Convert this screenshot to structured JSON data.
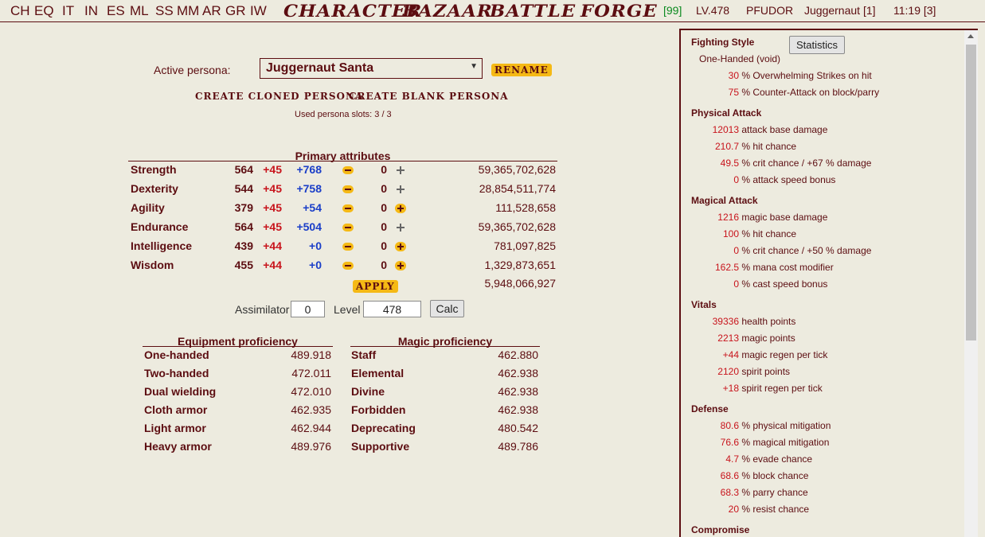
{
  "nav": {
    "shortcuts": [
      "CH",
      "EQ",
      "IT",
      "IN",
      "ES",
      "ML",
      "SS",
      "MM",
      "AR",
      "GR",
      "IW"
    ],
    "menus": [
      "CHARACTER",
      "BAZAAR",
      "BATTLE",
      "FORGE"
    ],
    "notice": "[99]",
    "level": "LV.478",
    "difficulty": "PFUDOR",
    "persona": "Juggernaut [1]",
    "time": "11:19 [3]"
  },
  "persona": {
    "label": "Active persona:",
    "selected": "Juggernaut Santa",
    "rename": "RENAME",
    "create_cloned": "CREATE CLONED PERSONA",
    "create_blank": "CREATE BLANK PERSONA",
    "slots": "Used persona slots: 3 / 3"
  },
  "primary": {
    "heading": "Primary attributes",
    "rows": [
      {
        "name": "Strength",
        "base": "564",
        "plus": "+45",
        "bonus": "+768",
        "value": "0",
        "inc_enabled": false,
        "exp": "59,365,702,628"
      },
      {
        "name": "Dexterity",
        "base": "544",
        "plus": "+45",
        "bonus": "+758",
        "value": "0",
        "inc_enabled": false,
        "exp": "28,854,511,774"
      },
      {
        "name": "Agility",
        "base": "379",
        "plus": "+45",
        "bonus": "+54",
        "value": "0",
        "inc_enabled": true,
        "exp": "111,528,658"
      },
      {
        "name": "Endurance",
        "base": "564",
        "plus": "+45",
        "bonus": "+504",
        "value": "0",
        "inc_enabled": false,
        "exp": "59,365,702,628"
      },
      {
        "name": "Intelligence",
        "base": "439",
        "plus": "+44",
        "bonus": "+0",
        "value": "0",
        "inc_enabled": true,
        "exp": "781,097,825"
      },
      {
        "name": "Wisdom",
        "base": "455",
        "plus": "+44",
        "bonus": "+0",
        "value": "0",
        "inc_enabled": true,
        "exp": "1,329,873,651"
      }
    ],
    "apply": "APPLY",
    "total_exp": "5,948,066,927"
  },
  "calc": {
    "assimilator_label": "Assimilator",
    "assimilator_value": "0",
    "level_label": "Level",
    "level_value": "478",
    "button": "Calc"
  },
  "equipment": {
    "heading": "Equipment proficiency",
    "rows": [
      {
        "name": "One-handed",
        "value": "489.918"
      },
      {
        "name": "Two-handed",
        "value": "472.011"
      },
      {
        "name": "Dual wielding",
        "value": "472.010"
      },
      {
        "name": "Cloth armor",
        "value": "462.935"
      },
      {
        "name": "Light armor",
        "value": "462.944"
      },
      {
        "name": "Heavy armor",
        "value": "489.976"
      }
    ]
  },
  "magic": {
    "heading": "Magic proficiency",
    "rows": [
      {
        "name": "Staff",
        "value": "462.880"
      },
      {
        "name": "Elemental",
        "value": "462.938"
      },
      {
        "name": "Divine",
        "value": "462.938"
      },
      {
        "name": "Forbidden",
        "value": "462.938"
      },
      {
        "name": "Deprecating",
        "value": "480.542"
      },
      {
        "name": "Supportive",
        "value": "489.786"
      }
    ]
  },
  "stats": {
    "button": "Statistics",
    "sections": [
      {
        "heading": "Fighting Style",
        "lines": [
          {
            "num": "",
            "text": "One-Handed (void)"
          },
          {
            "num": "30",
            "text": " % Overwhelming Strikes on hit"
          },
          {
            "num": "75",
            "text": " % Counter-Attack on block/parry"
          }
        ]
      },
      {
        "heading": "Physical Attack",
        "lines": [
          {
            "num": "12013",
            "text": " attack base damage"
          },
          {
            "num": "210.7",
            "text": " % hit chance"
          },
          {
            "num": "49.5",
            "text": " % crit chance / +67 % damage"
          },
          {
            "num": "0",
            "text": " % attack speed bonus"
          }
        ]
      },
      {
        "heading": "Magical Attack",
        "lines": [
          {
            "num": "1216",
            "text": " magic base damage"
          },
          {
            "num": "100",
            "text": " % hit chance"
          },
          {
            "num": "0",
            "text": " % crit chance / +50 % damage"
          },
          {
            "num": "162.5",
            "text": " % mana cost modifier"
          },
          {
            "num": "0",
            "text": " % cast speed bonus"
          }
        ]
      },
      {
        "heading": "Vitals",
        "lines": [
          {
            "num": "39336",
            "text": " health points"
          },
          {
            "num": "2213",
            "text": " magic points"
          },
          {
            "num": "+44",
            "text": " magic regen per tick"
          },
          {
            "num": "2120",
            "text": " spirit points"
          },
          {
            "num": "+18",
            "text": " spirit regen per tick"
          }
        ]
      },
      {
        "heading": "Defense",
        "lines": [
          {
            "num": "80.6",
            "text": " % physical mitigation"
          },
          {
            "num": "76.6",
            "text": " % magical mitigation"
          },
          {
            "num": "4.7",
            "text": " % evade chance"
          },
          {
            "num": "68.6",
            "text": " % block chance"
          },
          {
            "num": "68.3",
            "text": " % parry chance"
          },
          {
            "num": "20",
            "text": " % resist chance"
          }
        ]
      },
      {
        "heading": "Compromise",
        "lines": []
      }
    ]
  }
}
